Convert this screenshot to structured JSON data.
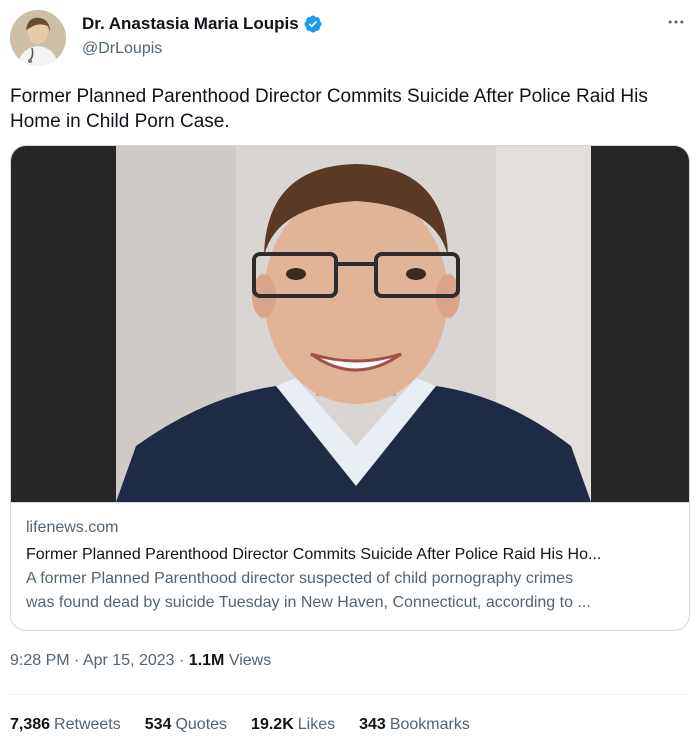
{
  "author": {
    "display_name": "Dr. Anastasia Maria Loupis",
    "handle": "@DrLoupis",
    "verified": true
  },
  "more_icon": "more-horizontal-icon",
  "tweet": {
    "text": "Former Planned Parenthood Director Commits Suicide After Police Raid His Home in Child Porn Case."
  },
  "card": {
    "domain": "lifenews.com",
    "title": "Former Planned Parenthood Director Commits Suicide After Police Raid His Ho...",
    "description_line1": "A former Planned Parenthood director suspected of child pornography crimes",
    "description_line2": "was found dead by suicide Tuesday in New Haven, Connecticut, according to ..."
  },
  "meta": {
    "time": "9:28 PM",
    "separator": "·",
    "date": "Apr 15, 2023",
    "views_count": "1.1M",
    "views_label": "Views"
  },
  "stats": {
    "retweets_count": "7,386",
    "retweets_label": "Retweets",
    "quotes_count": "534",
    "quotes_label": "Quotes",
    "likes_count": "19.2K",
    "likes_label": "Likes",
    "bookmarks_count": "343",
    "bookmarks_label": "Bookmarks"
  },
  "colors": {
    "verified_blue": "#1d9bf0",
    "secondary_text": "#536471",
    "primary_text": "#0f1419"
  }
}
